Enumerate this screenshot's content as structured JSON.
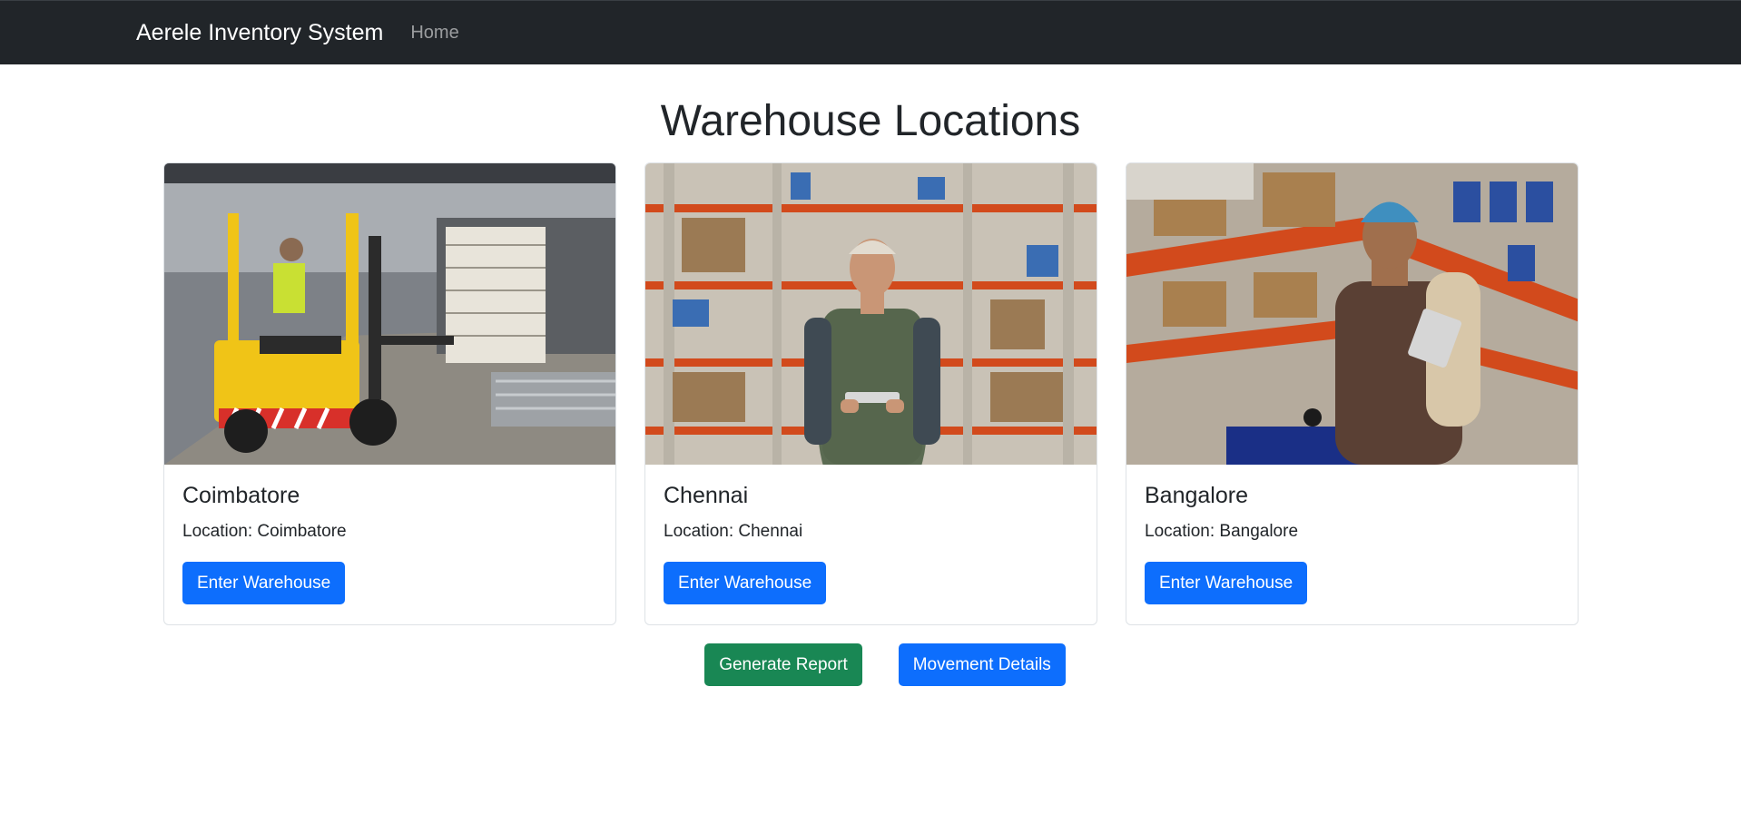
{
  "navbar": {
    "brand": "Aerele Inventory System",
    "home": "Home"
  },
  "page": {
    "title": "Warehouse Locations"
  },
  "warehouses": [
    {
      "name": "Coimbatore",
      "location": "Location: Coimbatore",
      "button": "Enter Warehouse",
      "image": "forklift-warehouse-photo"
    },
    {
      "name": "Chennai",
      "location": "Location: Chennai",
      "button": "Enter Warehouse",
      "image": "worker-with-tablet-photo"
    },
    {
      "name": "Bangalore",
      "location": "Location: Bangalore",
      "button": "Enter Warehouse",
      "image": "worker-on-shelves-photo"
    }
  ],
  "actions": {
    "report": "Generate Report",
    "movement": "Movement Details"
  },
  "colors": {
    "navbar": "#212529",
    "primary": "#0d6efd",
    "success": "#198754"
  }
}
